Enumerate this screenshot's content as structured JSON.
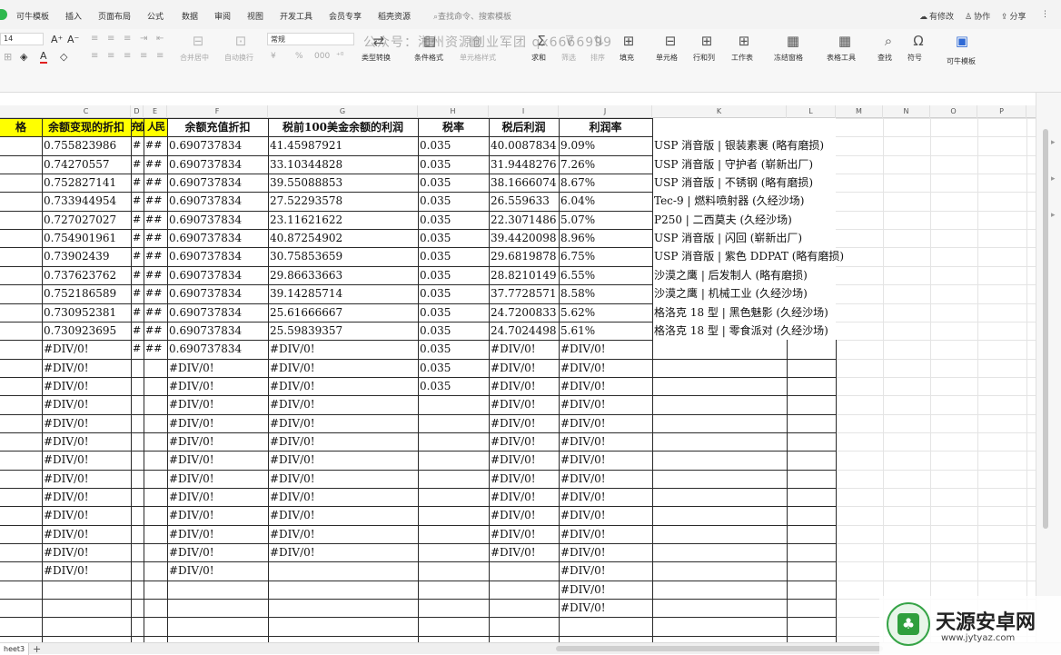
{
  "menubar": {
    "items": [
      "可牛模板",
      "插入",
      "页面布局",
      "公式",
      "数据",
      "审阅",
      "视图",
      "开发工具",
      "会员专享",
      "稻壳资源"
    ],
    "search": "查找命令、搜索模板",
    "right": {
      "modified": "有修改",
      "collab": "协作",
      "share": "分享"
    }
  },
  "ribbon": {
    "font_size": "14",
    "number_format": "常规",
    "watermark": "公众号：湘州资源创业军团 qx6666999",
    "buttons": {
      "merge_center": "合并居中",
      "wrap": "自动换行",
      "type_convert": "类型转换",
      "cond_format": "条件格式",
      "cell_style": "单元格样式",
      "sum": "求和",
      "filter": "筛选",
      "sort": "排序",
      "fill": "填充",
      "cell": "单元格",
      "row_col": "行和列",
      "worksheet": "工作表",
      "freeze": "冻结窗格",
      "table_tools": "表格工具",
      "find": "查找",
      "symbol": "符号",
      "template": "可牛模板"
    }
  },
  "grid": {
    "column_letters": [
      "C",
      "D",
      "E",
      "F",
      "G",
      "H",
      "I",
      "J",
      "K",
      "L",
      "M",
      "N",
      "O",
      "P"
    ],
    "headers": {
      "b": "格",
      "c": "余额变现的折扣",
      "d": "充值",
      "e": "人民",
      "f": "余额充值折扣",
      "g": "税前100美金余额的利润",
      "h": "税率",
      "i": "税后利润",
      "j": "利润率"
    },
    "rows": [
      {
        "c": "0.755823986",
        "d": "#",
        "e": "##",
        "f": "0.690737834",
        "g": "41.45987921",
        "h": "0.035",
        "i": "40.0087834",
        "j": "9.09%",
        "k": "USP 消音版 | 银装素裹 (略有磨损)"
      },
      {
        "c": "0.74270557",
        "d": "#",
        "e": "##",
        "f": "0.690737834",
        "g": "33.10344828",
        "h": "0.035",
        "i": "31.9448276",
        "j": "7.26%",
        "k": "USP 消音版 | 守护者 (崭新出厂)"
      },
      {
        "c": "0.752827141",
        "d": "#",
        "e": "##",
        "f": "0.690737834",
        "g": "39.55088853",
        "h": "0.035",
        "i": "38.1666074",
        "j": "8.67%",
        "k": "USP 消音版 | 不锈钢 (略有磨损)"
      },
      {
        "c": "0.733944954",
        "d": "#",
        "e": "##",
        "f": "0.690737834",
        "g": "27.52293578",
        "h": "0.035",
        "i": "26.559633",
        "j": "6.04%",
        "k": "Tec-9 | 燃料喷射器 (久经沙场)"
      },
      {
        "c": "0.727027027",
        "d": "#",
        "e": "##",
        "f": "0.690737834",
        "g": "23.11621622",
        "h": "0.035",
        "i": "22.3071486",
        "j": "5.07%",
        "k": "P250 | 二西莫夫 (久经沙场)"
      },
      {
        "c": "0.754901961",
        "d": "#",
        "e": "##",
        "f": "0.690737834",
        "g": "40.87254902",
        "h": "0.035",
        "i": "39.4420098",
        "j": "8.96%",
        "k": "USP 消音版 | 闪回 (崭新出厂)"
      },
      {
        "c": "0.73902439",
        "d": "#",
        "e": "##",
        "f": "0.690737834",
        "g": "30.75853659",
        "h": "0.035",
        "i": "29.6819878",
        "j": "6.75%",
        "k": "USP 消音版 | 紫色 DDPAT (略有磨损)"
      },
      {
        "c": "0.737623762",
        "d": "#",
        "e": "##",
        "f": "0.690737834",
        "g": "29.86633663",
        "h": "0.035",
        "i": "28.8210149",
        "j": "6.55%",
        "k": "沙漠之鹰 | 后发制人 (略有磨损)"
      },
      {
        "c": "0.752186589",
        "d": "#",
        "e": "##",
        "f": "0.690737834",
        "g": "39.14285714",
        "h": "0.035",
        "i": "37.7728571",
        "j": "8.58%",
        "k": "沙漠之鹰 | 机械工业 (久经沙场)"
      },
      {
        "c": "0.730952381",
        "d": "#",
        "e": "##",
        "f": "0.690737834",
        "g": "25.61666667",
        "h": "0.035",
        "i": "24.7200833",
        "j": "5.62%",
        "k": "格洛克 18 型 | 黑色魅影 (久经沙场)"
      },
      {
        "c": "0.730923695",
        "d": "#",
        "e": "##",
        "f": "0.690737834",
        "g": "25.59839357",
        "h": "0.035",
        "i": "24.7024498",
        "j": "5.61%",
        "k": "格洛克 18 型 | 零食派对 (久经沙场)"
      },
      {
        "c": "#DIV/0!",
        "d": "#",
        "e": "##",
        "f": "0.690737834",
        "g": "#DIV/0!",
        "h": "0.035",
        "i": "#DIV/0!",
        "j": "#DIV/0!",
        "k": ""
      },
      {
        "c": "#DIV/0!",
        "d": "",
        "e": "",
        "f": "#DIV/0!",
        "g": "#DIV/0!",
        "h": "0.035",
        "i": "#DIV/0!",
        "j": "#DIV/0!",
        "k": ""
      },
      {
        "c": "#DIV/0!",
        "d": "",
        "e": "",
        "f": "#DIV/0!",
        "g": "#DIV/0!",
        "h": "0.035",
        "i": "#DIV/0!",
        "j": "#DIV/0!",
        "k": ""
      },
      {
        "c": "#DIV/0!",
        "d": "",
        "e": "",
        "f": "#DIV/0!",
        "g": "#DIV/0!",
        "h": "",
        "i": "#DIV/0!",
        "j": "#DIV/0!",
        "k": ""
      },
      {
        "c": "#DIV/0!",
        "d": "",
        "e": "",
        "f": "#DIV/0!",
        "g": "#DIV/0!",
        "h": "",
        "i": "#DIV/0!",
        "j": "#DIV/0!",
        "k": ""
      },
      {
        "c": "#DIV/0!",
        "d": "",
        "e": "",
        "f": "#DIV/0!",
        "g": "#DIV/0!",
        "h": "",
        "i": "#DIV/0!",
        "j": "#DIV/0!",
        "k": ""
      },
      {
        "c": "#DIV/0!",
        "d": "",
        "e": "",
        "f": "#DIV/0!",
        "g": "#DIV/0!",
        "h": "",
        "i": "#DIV/0!",
        "j": "#DIV/0!",
        "k": ""
      },
      {
        "c": "#DIV/0!",
        "d": "",
        "e": "",
        "f": "#DIV/0!",
        "g": "#DIV/0!",
        "h": "",
        "i": "#DIV/0!",
        "j": "#DIV/0!",
        "k": ""
      },
      {
        "c": "#DIV/0!",
        "d": "",
        "e": "",
        "f": "#DIV/0!",
        "g": "#DIV/0!",
        "h": "",
        "i": "#DIV/0!",
        "j": "#DIV/0!",
        "k": ""
      },
      {
        "c": "#DIV/0!",
        "d": "",
        "e": "",
        "f": "#DIV/0!",
        "g": "#DIV/0!",
        "h": "",
        "i": "#DIV/0!",
        "j": "#DIV/0!",
        "k": ""
      },
      {
        "c": "#DIV/0!",
        "d": "",
        "e": "",
        "f": "#DIV/0!",
        "g": "#DIV/0!",
        "h": "",
        "i": "#DIV/0!",
        "j": "#DIV/0!",
        "k": ""
      },
      {
        "c": "#DIV/0!",
        "d": "",
        "e": "",
        "f": "#DIV/0!",
        "g": "#DIV/0!",
        "h": "",
        "i": "#DIV/0!",
        "j": "#DIV/0!",
        "k": ""
      },
      {
        "c": "#DIV/0!",
        "d": "",
        "e": "",
        "f": "#DIV/0!",
        "g": "",
        "h": "",
        "i": "",
        "j": "#DIV/0!",
        "k": ""
      },
      {
        "c": "",
        "d": "",
        "e": "",
        "f": "",
        "g": "",
        "h": "",
        "i": "",
        "j": "#DIV/0!",
        "k": ""
      },
      {
        "c": "",
        "d": "",
        "e": "",
        "f": "",
        "g": "",
        "h": "",
        "i": "",
        "j": "#DIV/0!",
        "k": ""
      }
    ]
  },
  "bottom": {
    "sheet_tab": "heet3",
    "add": "+",
    "logo_text": "天源安卓网",
    "logo_url": "www.jytyaz.com"
  },
  "colors": {
    "header_yellow": "#ffff00",
    "brand_green": "#2db84d"
  }
}
